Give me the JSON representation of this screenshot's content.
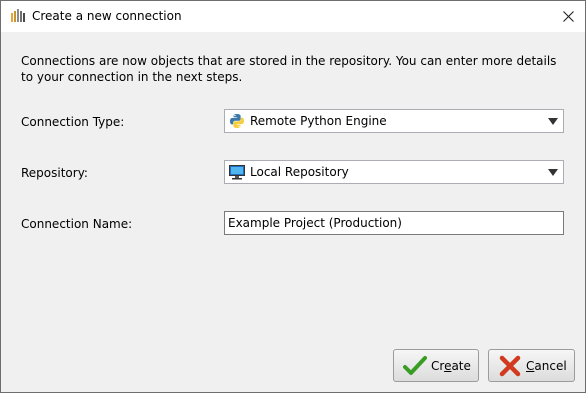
{
  "window": {
    "title": "Create a new connection",
    "icons": {
      "app": "app-logo-icon",
      "close": "close-icon"
    }
  },
  "intro_text": "Connections are now objects that are stored in the repository. You can enter more details to your connection in the next steps.",
  "form": {
    "connection_type": {
      "label": "Connection Type:",
      "value": "Remote Python Engine",
      "icon": "python-icon"
    },
    "repository": {
      "label": "Repository:",
      "value": "Local Repository",
      "icon": "monitor-icon"
    },
    "connection_name": {
      "label": "Connection Name:",
      "value": "Example Project (Production)"
    }
  },
  "buttons": {
    "create": {
      "pre": "Cr",
      "mnemonic": "e",
      "post": "ate",
      "icon": "checkmark-icon"
    },
    "cancel": {
      "pre": "",
      "mnemonic": "C",
      "post": "ancel",
      "icon": "x-icon"
    }
  },
  "colors": {
    "check_green": "#3a9d23",
    "cancel_red": "#d23a1f",
    "dialog_bg": "#f0f0f0"
  }
}
